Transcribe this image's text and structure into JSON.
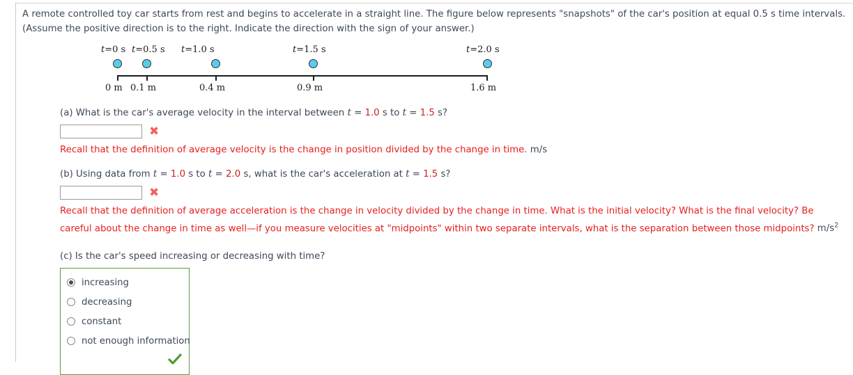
{
  "problem": {
    "line1": "A remote controlled toy car starts from rest and begins to accelerate in a straight line. The figure below represents \"snapshots\" of the car's position at equal 0.5 s time intervals.",
    "line2": "(Assume the positive direction is to the right. Indicate the direction with the sign of your answer.)"
  },
  "figure": {
    "time_prefix": "t",
    "equals": "=",
    "snapshots": [
      {
        "time_label": "0 s",
        "distance_label": "0 m",
        "time": 0.0,
        "position": 0.0
      },
      {
        "time_label": "0.5 s",
        "distance_label": "0.1 m",
        "time": 0.5,
        "position": 0.1
      },
      {
        "time_label": "1.0 s",
        "distance_label": "0.4 m",
        "time": 1.0,
        "position": 0.4
      },
      {
        "time_label": "1.5 s",
        "distance_label": "0.9 m",
        "time": 1.5,
        "position": 0.9
      },
      {
        "time_label": "2.0 s",
        "distance_label": "1.6 m",
        "time": 2.0,
        "position": 1.6
      }
    ],
    "dot_color": "#5ccbe8",
    "axis_color": "#1b1b1b"
  },
  "parts": {
    "a": {
      "prompt_prefix": "(a) What is the car's average velocity in the interval between ",
      "t_symbol": "t",
      "eq": " = ",
      "t_start": "1.0",
      "mid": " s to ",
      "t_end": "1.5",
      "suffix": " s?",
      "input_value": "",
      "input_placeholder": "",
      "mark": "✖",
      "feedback": "Recall that the definition of average velocity is the change in position divided by the change in time.",
      "unit": "m/s"
    },
    "b": {
      "prompt_prefix": "(b) Using data from ",
      "t_symbol": "t",
      "eq": " = ",
      "t_start": "1.0",
      "mid": " s to ",
      "t_end": "2.0",
      "mid2": " s, what is the car's acceleration at ",
      "t_at": "1.5",
      "suffix": " s?",
      "input_value": "",
      "input_placeholder": "",
      "mark": "✖",
      "feedback": "Recall that the definition of average acceleration is the change in velocity divided by the change in time. What is the initial velocity? What is the final velocity? Be careful about the change in time as well—if you measure velocities at \"midpoints\" within two separate intervals, what is the separation between those midpoints?",
      "unit_base": "m/s",
      "unit_exp": "2"
    },
    "c": {
      "prompt": "(c) Is the car's speed increasing or decreasing with time?",
      "options": [
        {
          "label": "increasing",
          "selected": true
        },
        {
          "label": "decreasing",
          "selected": false
        },
        {
          "label": "constant",
          "selected": false
        },
        {
          "label": "not enough information",
          "selected": false
        }
      ],
      "correct_border_color": "#5b9b3e",
      "check_color": "#4f9b30"
    }
  }
}
